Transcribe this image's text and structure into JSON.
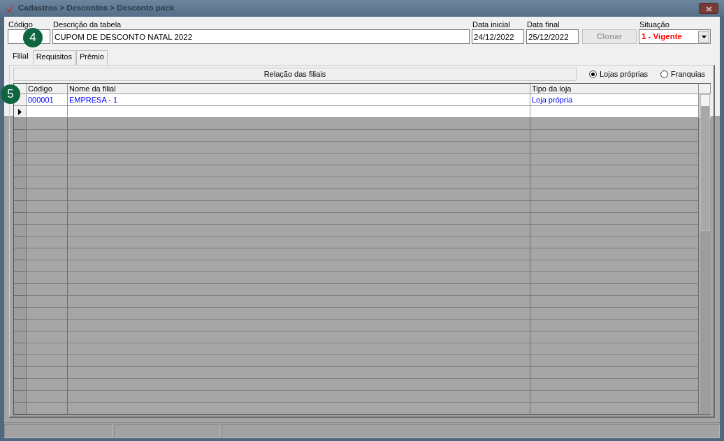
{
  "window": {
    "title": "Cadastros > Descontos > Desconto pack"
  },
  "fields": [
    {
      "label": "Código",
      "kind": "text"
    },
    {
      "label": "Descrição da tabela",
      "value": "CUPOM DE DESCONTO NATAL 2022",
      "kind": "text"
    },
    {
      "label": "Data inicial",
      "value": "24/12/2022",
      "kind": "text"
    },
    {
      "label": "Data final",
      "value": "25/12/2022",
      "kind": "text"
    },
    {
      "label": "Clonar",
      "kind": "button",
      "disabled": true
    },
    {
      "label": "Situação",
      "value": "1 - Vigente",
      "kind": "select"
    }
  ],
  "tabs": [
    {
      "label": "Filial",
      "selected": true
    },
    {
      "label": "Requisitos",
      "selected": false
    },
    {
      "label": "Prêmio",
      "selected": false
    }
  ],
  "section_title": "Relação das filiais",
  "radios": [
    {
      "label": "Lojas próprias",
      "selected": true
    },
    {
      "label": "Franquias",
      "selected": false
    }
  ],
  "table": {
    "columns": [
      "Código",
      "Nome da filial",
      "Tipo da loja"
    ],
    "rows": [
      {
        "cells": [
          "000001",
          "EMPRESA - 1",
          "Loja própria"
        ],
        "current": false
      },
      {
        "cells": [],
        "current": true
      }
    ]
  },
  "callouts": [
    "4",
    "5"
  ]
}
